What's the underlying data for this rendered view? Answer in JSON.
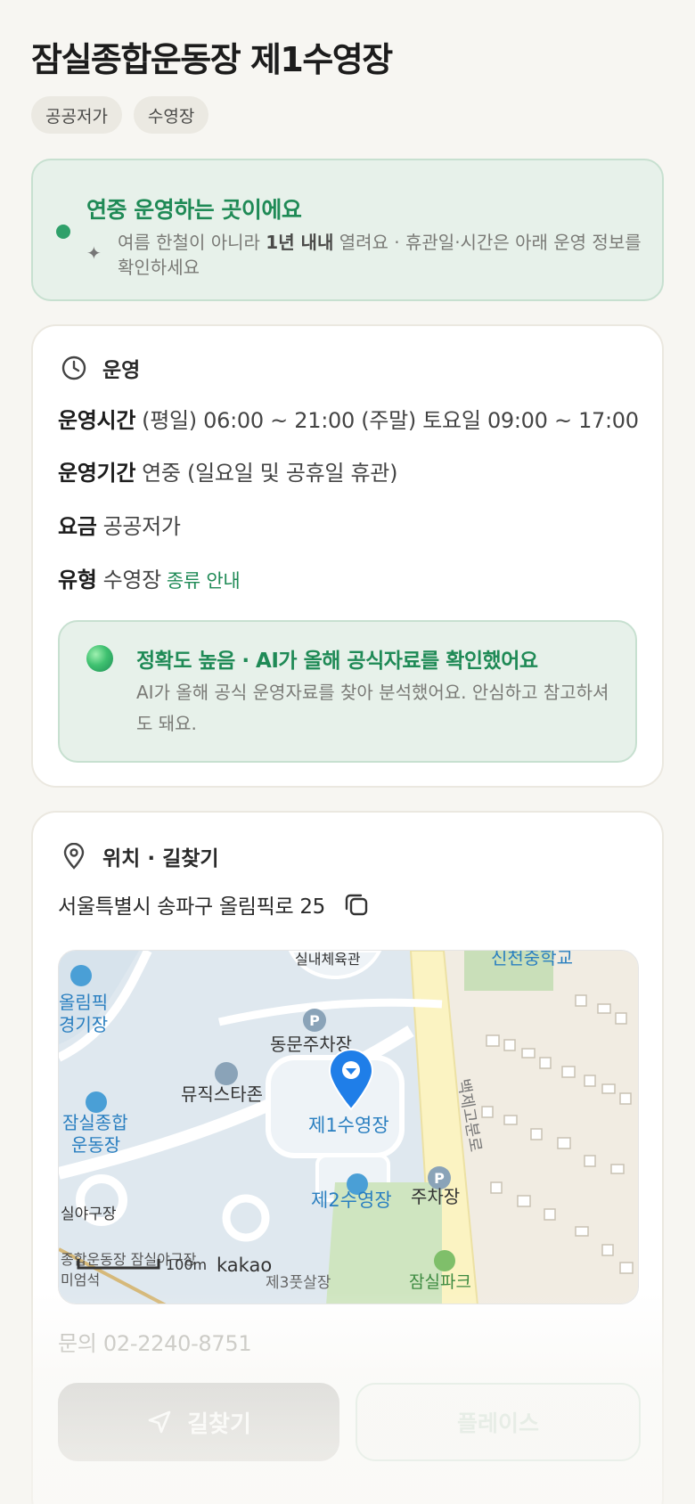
{
  "title": "잠실종합운동장 제1수영장",
  "tags": [
    "공공저가",
    "수영장"
  ],
  "notice": {
    "heading": "연중 운영하는 곳이에요",
    "body_before": "여름 한철이 아니라 ",
    "body_bold": "1년 내내",
    "body_after": " 열려요 · 휴관일·시간은 아래 운영 정보를 확인하세요"
  },
  "operation": {
    "heading": "운영",
    "hours_label": "운영시간",
    "hours_value": "(평일) 06:00 ~ 21:00 (주말) 토요일 09:00 ~ 17:00",
    "period_label": "운영기간",
    "period_value": "연중 (일요일 및 공휴일 휴관)",
    "fee_label": "요금",
    "fee_value": "공공저가",
    "type_label": "유형",
    "type_value": "수영장",
    "type_link": "종류 안내"
  },
  "accuracy": {
    "heading": "정확도 높음 · AI가 올해 공식자료를 확인했어요",
    "body": "AI가 올해 공식 운영자료를 찾아 분석했어요. 안심하고 참고하셔도 돼요."
  },
  "location": {
    "heading": "위치 · 길찾기",
    "address": "서울특별시 송파구 올림픽로 25"
  },
  "map": {
    "labels": {
      "gym": "실내체육관",
      "school": "신천중학교",
      "olympic": "올림픽",
      "stadium_short": "경기장",
      "east_parking": "동문주차장",
      "museum": "뮤직스타존",
      "pool1": "제1수영장",
      "main_stadium_1": "잠실종합",
      "main_stadium_2": "운동장",
      "baekje": "백제고분로",
      "pool2": "제2수영장",
      "parking": "주차장",
      "baseball": "실야구장",
      "museum2": "종합운동장 잠실야구장",
      "museum3": "미엄석",
      "scale": "100m",
      "brand": "kakao",
      "futsal": "제3풋살장",
      "park": "잠실파크"
    },
    "parking_letter": "P"
  },
  "contact": "문의 02-2240-8751",
  "buttons": {
    "directions": "길찾기",
    "place": "플레이스"
  }
}
